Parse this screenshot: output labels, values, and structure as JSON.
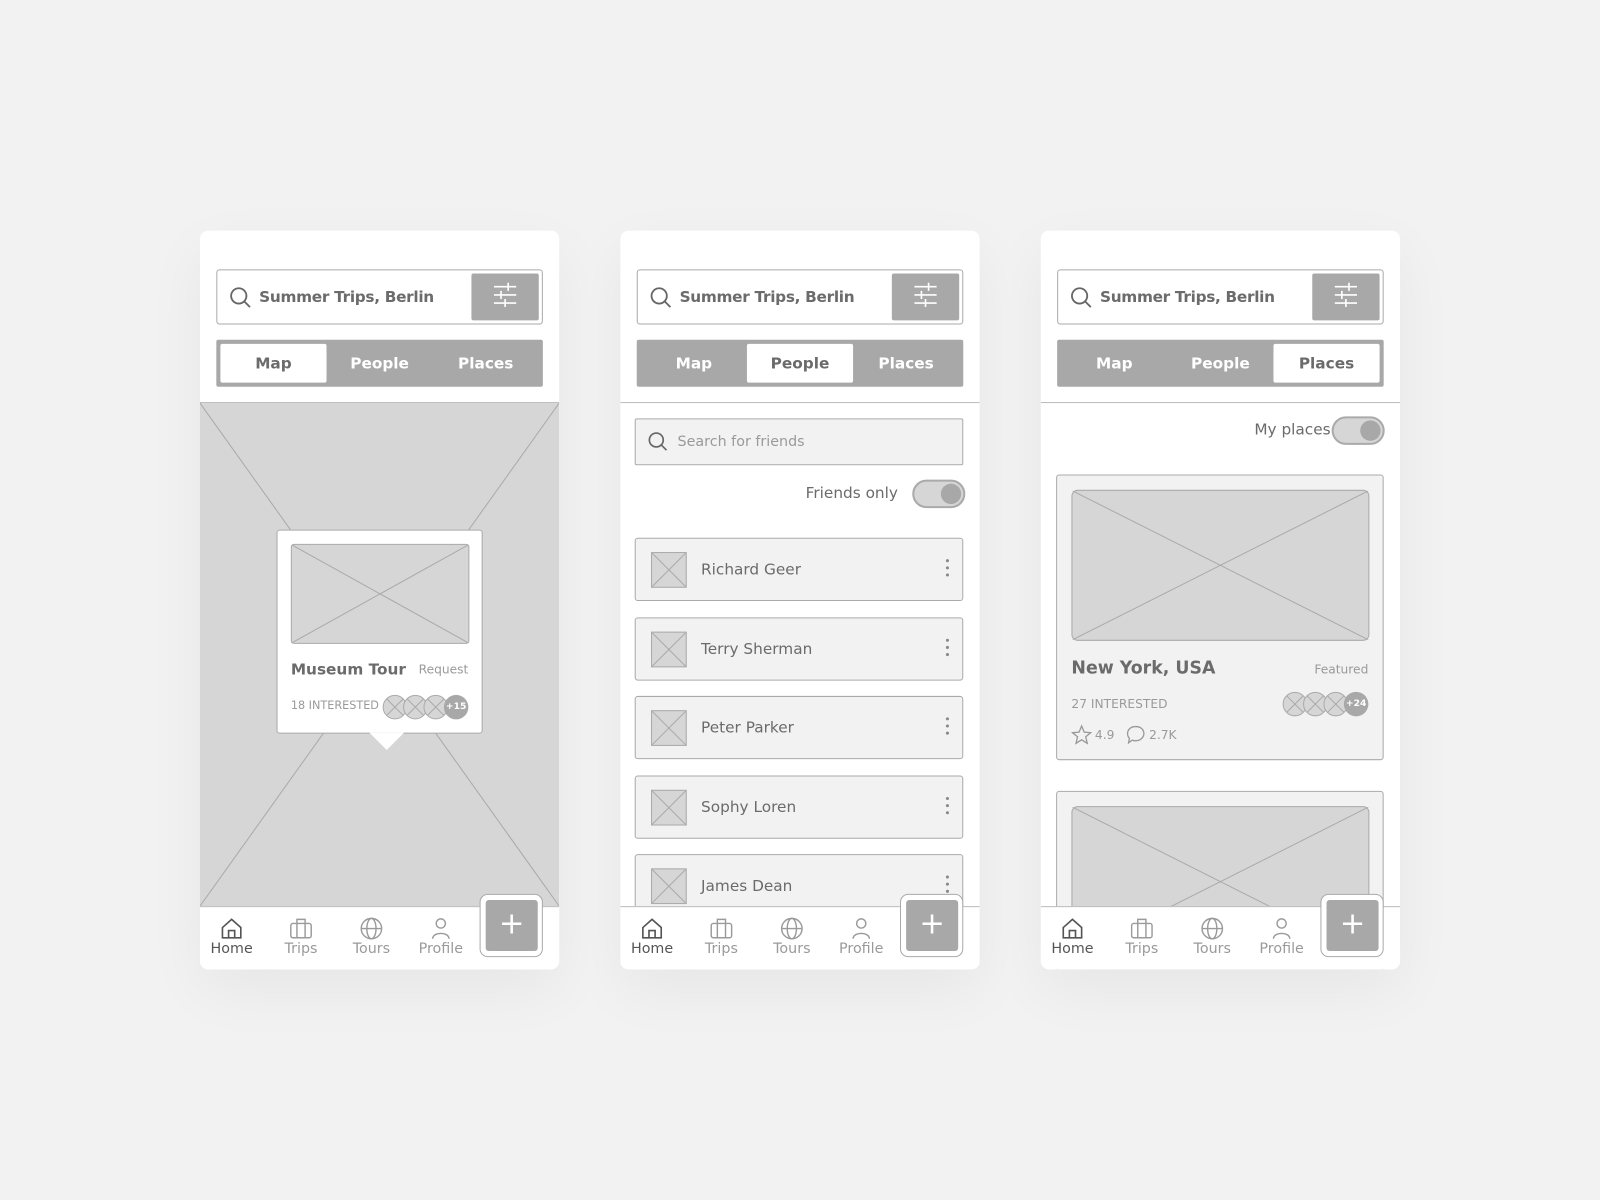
{
  "colors": {
    "background": "#f2f2f2",
    "accent_gray": "#a8a8a8",
    "placeholder": "#d6d6d6",
    "text": "#6b6b6b"
  },
  "screens": [
    {
      "search": {
        "query": "Summer Trips, Berlin",
        "icon": "search-icon",
        "filter_icon": "sliders-icon"
      },
      "tabs": [
        {
          "label": "Map",
          "active": true
        },
        {
          "label": "People",
          "active": false
        },
        {
          "label": "Places",
          "active": false
        }
      ],
      "popup": {
        "title": "Museum Tour",
        "action": "Request",
        "interested": "18 INTERESTED",
        "more": "+15"
      },
      "nav": [
        {
          "label": "Home",
          "icon": "home-icon",
          "active": true
        },
        {
          "label": "Trips",
          "icon": "briefcase-icon"
        },
        {
          "label": "Tours",
          "icon": "globe-icon"
        },
        {
          "label": "Profile",
          "icon": "user-icon"
        }
      ],
      "fab": "+"
    },
    {
      "search": {
        "query": "Summer Trips, Berlin"
      },
      "tabs": [
        {
          "label": "Map",
          "active": false
        },
        {
          "label": "People",
          "active": true
        },
        {
          "label": "Places",
          "active": false
        }
      ],
      "friend_search": {
        "placeholder": "Search for friends"
      },
      "toggle": {
        "label": "Friends only",
        "on": true
      },
      "people": [
        "Richard Geer",
        "Terry Sherman",
        "Peter Parker",
        "Sophy Loren",
        "James Dean"
      ],
      "nav": [
        {
          "label": "Home",
          "active": true
        },
        {
          "label": "Trips"
        },
        {
          "label": "Tours"
        },
        {
          "label": "Profile"
        }
      ],
      "fab": "+"
    },
    {
      "search": {
        "query": "Summer Trips, Berlin"
      },
      "tabs": [
        {
          "label": "Map",
          "active": false
        },
        {
          "label": "People",
          "active": false
        },
        {
          "label": "Places",
          "active": true
        }
      ],
      "toggle": {
        "label": "My places",
        "on": true
      },
      "place": {
        "title": "New York, USA",
        "badge": "Featured",
        "interested": "27 INTERESTED",
        "more": "+24",
        "rating": "4.9",
        "comments": "2.7K"
      },
      "nav": [
        {
          "label": "Home",
          "active": true
        },
        {
          "label": "Trips"
        },
        {
          "label": "Tours"
        },
        {
          "label": "Profile"
        }
      ],
      "fab": "+"
    }
  ]
}
